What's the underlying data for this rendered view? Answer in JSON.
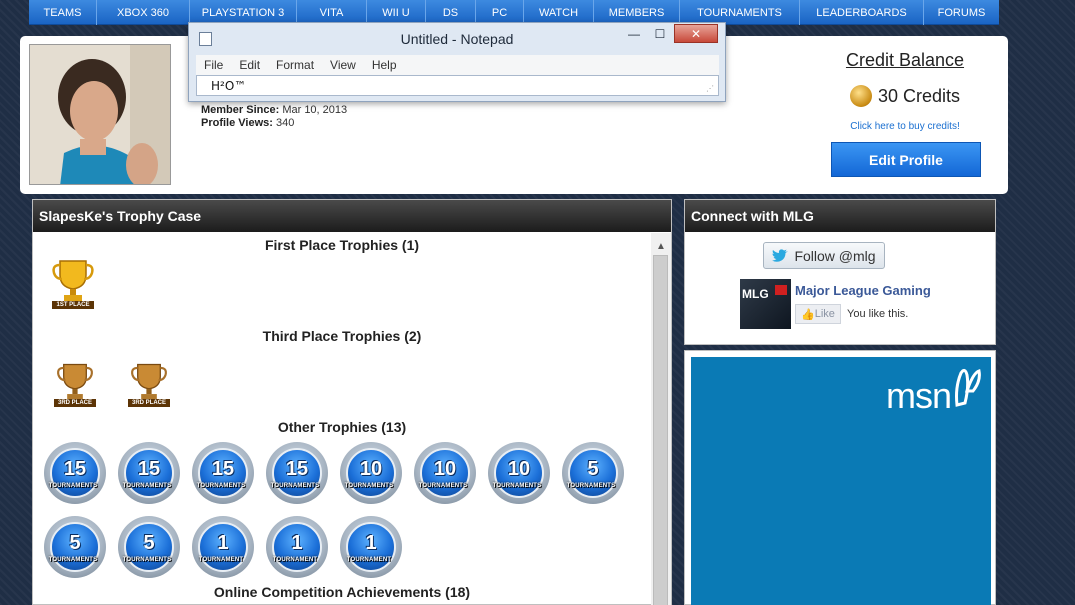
{
  "nav": {
    "items": [
      "TEAMS",
      "XBOX 360",
      "PLAYSTATION 3",
      "VITA",
      "WII U",
      "DS",
      "PC",
      "WATCH",
      "MEMBERS",
      "TOURNAMENTS",
      "LEADERBOARDS",
      "FORUMS"
    ]
  },
  "notepad": {
    "title": "Untitled - Notepad",
    "menu": [
      "File",
      "Edit",
      "Format",
      "View",
      "Help"
    ],
    "content": "H²O™",
    "minimize": "—",
    "maximize": "☐",
    "close": "✕"
  },
  "profile": {
    "member_since_label": "Member Since:",
    "member_since_value": "Mar 10, 2013",
    "views_label": "Profile Views:",
    "views_value": "340"
  },
  "credits": {
    "title": "Credit Balance",
    "amount": "30 Credits",
    "buy_link": "Click here to buy credits!",
    "edit_button": "Edit Profile"
  },
  "trophy_case": {
    "header": "SlapesKe's Trophy Case",
    "first_title": "First Place Trophies (1)",
    "third_title": "Third Place Trophies (2)",
    "other_title": "Other Trophies (13)",
    "online_title": "Online Competition Achievements (18)",
    "first_label": "1ST PLACE",
    "third_label": "3RD PLACE",
    "medals": [
      {
        "num": "15",
        "label": "TOURNAMENTS"
      },
      {
        "num": "15",
        "label": "TOURNAMENTS"
      },
      {
        "num": "15",
        "label": "TOURNAMENTS"
      },
      {
        "num": "15",
        "label": "TOURNAMENTS"
      },
      {
        "num": "10",
        "label": "TOURNAMENTS"
      },
      {
        "num": "10",
        "label": "TOURNAMENTS"
      },
      {
        "num": "10",
        "label": "TOURNAMENTS"
      },
      {
        "num": "5",
        "label": "TOURNAMENTS"
      },
      {
        "num": "5",
        "label": "TOURNAMENTS"
      },
      {
        "num": "5",
        "label": "TOURNAMENTS"
      },
      {
        "num": "1",
        "label": "TOURNAMENT"
      },
      {
        "num": "1",
        "label": "TOURNAMENT"
      },
      {
        "num": "1",
        "label": "TOURNAMENT"
      }
    ]
  },
  "connect": {
    "header": "Connect with MLG",
    "follow": "Follow @mlg",
    "logo_text": "MLG",
    "page_name": "Major League Gaming",
    "like": "Like",
    "like_status": "You like this."
  },
  "ad": {
    "brand": "msn"
  },
  "colors": {
    "nav_blue": "#1a64c4",
    "button_blue": "#1367d6",
    "medal_blue": "#1b6fd8",
    "msn_blue": "#0a7ab5"
  }
}
